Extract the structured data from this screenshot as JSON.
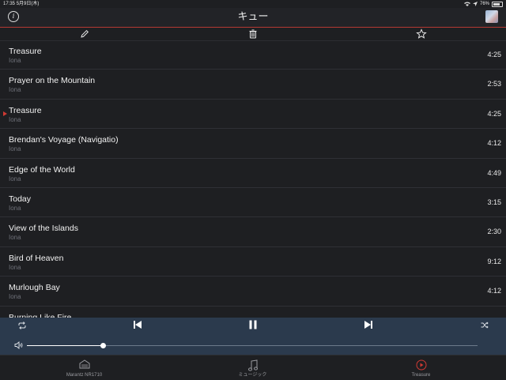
{
  "status": {
    "time": "17:35",
    "date": "5月9日(木)",
    "battery": "76%"
  },
  "header": {
    "title": "キュー"
  },
  "queue": [
    {
      "title": "Treasure",
      "artist": "Iona",
      "duration": "4:25",
      "playing": false
    },
    {
      "title": "Prayer on the Mountain",
      "artist": "Iona",
      "duration": "2:53",
      "playing": false
    },
    {
      "title": "Treasure",
      "artist": "Iona",
      "duration": "4:25",
      "playing": true
    },
    {
      "title": "Brendan's Voyage (Navigatio)",
      "artist": "Iona",
      "duration": "4:12",
      "playing": false
    },
    {
      "title": "Edge of the World",
      "artist": "Iona",
      "duration": "4:49",
      "playing": false
    },
    {
      "title": "Today",
      "artist": "Iona",
      "duration": "3:15",
      "playing": false
    },
    {
      "title": "View of the Islands",
      "artist": "Iona",
      "duration": "2:30",
      "playing": false
    },
    {
      "title": "Bird of Heaven",
      "artist": "Iona",
      "duration": "9:12",
      "playing": false
    },
    {
      "title": "Murlough Bay",
      "artist": "Iona",
      "duration": "4:12",
      "playing": false
    },
    {
      "title": "Burning Like Fire",
      "artist": "",
      "duration": "",
      "playing": false
    }
  ],
  "player": {
    "volume": 0.17
  },
  "tabs": [
    {
      "label": "Marantz NR1710",
      "icon": "receiver-icon"
    },
    {
      "label": "ミュージック",
      "icon": "music-note-icon"
    },
    {
      "label": "Treasure",
      "icon": "now-playing-icon"
    }
  ],
  "colors": {
    "accent": "#d03a33",
    "controls_bg": "#2b3a4d",
    "background": "#1e1f22"
  }
}
